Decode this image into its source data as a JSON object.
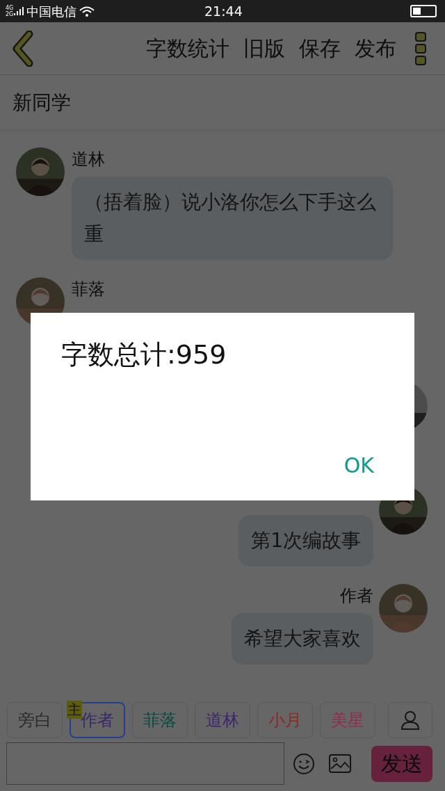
{
  "status_bar": {
    "network_top": "4G",
    "network_bottom": "2G",
    "carrier": "中国电信",
    "time": "21:44"
  },
  "toolbar": {
    "actions": [
      "字数统计",
      "旧版",
      "保存",
      "发布"
    ]
  },
  "chat_title": "新同学",
  "messages": [
    {
      "kind": "incoming",
      "name": "道林",
      "text": "（捂着脸）说小洛你怎么下手这么重"
    },
    {
      "kind": "incoming",
      "name": "菲落"
    },
    {
      "kind": "outgoing"
    },
    {
      "kind": "outgoing",
      "text": "第1次编故事"
    },
    {
      "kind": "outgoing",
      "name": "作者",
      "text": "希望大家喜欢"
    }
  ],
  "roles": [
    {
      "label": "旁白",
      "color": "#2a2a2a",
      "selected": false
    },
    {
      "label": "作者",
      "color": "#3a2868",
      "selected": true,
      "badge": "主"
    },
    {
      "label": "菲落",
      "color": "#064a40",
      "selected": false
    },
    {
      "label": "道林",
      "color": "#3e2470",
      "selected": false
    },
    {
      "label": "小月",
      "color": "#8c2a22",
      "selected": false
    },
    {
      "label": "美星",
      "color": "#902c4e",
      "selected": false
    }
  ],
  "composer": {
    "send": "发送"
  },
  "dialog": {
    "message": "字数总计:959",
    "ok": "OK"
  }
}
